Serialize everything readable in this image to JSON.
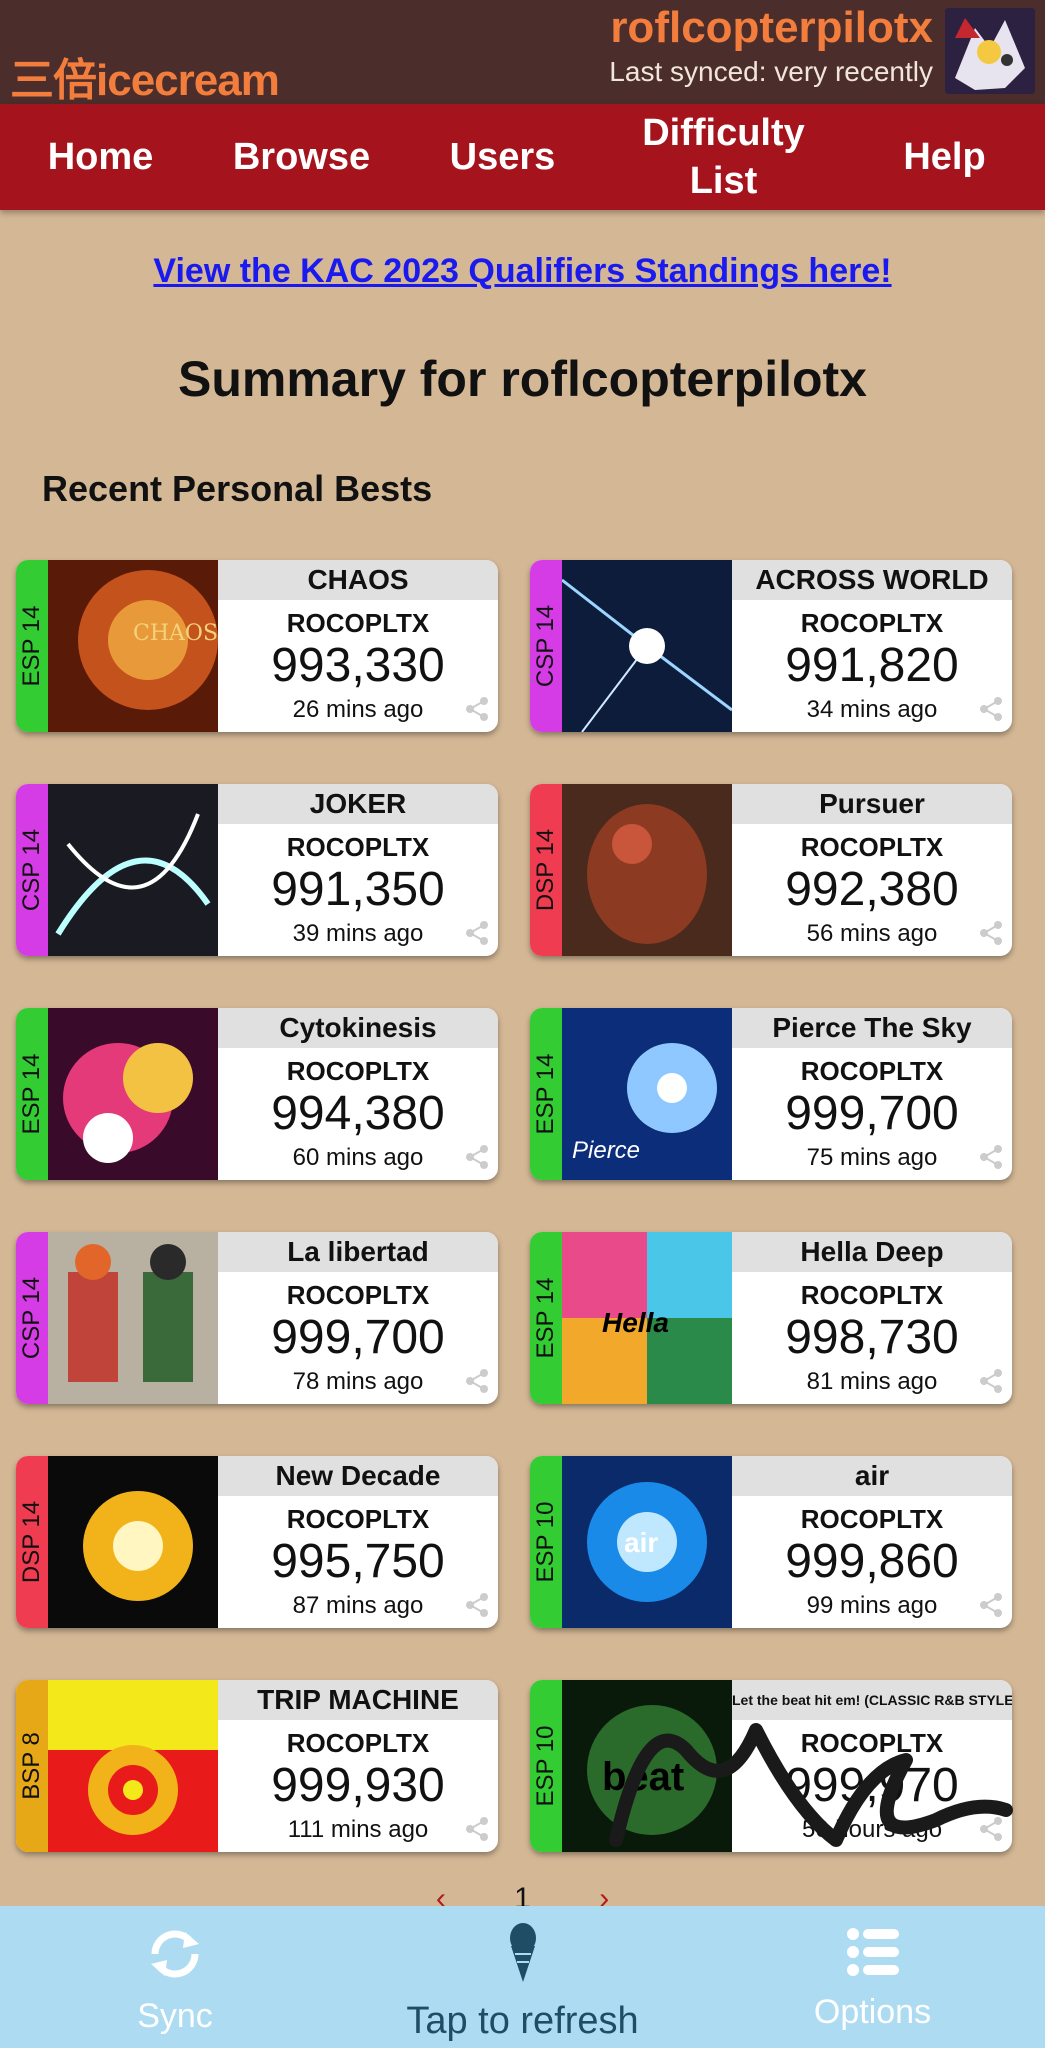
{
  "header": {
    "logo": "三倍icecream",
    "username": "roflcopterpilotx",
    "synced": "Last synced: very recently"
  },
  "nav": {
    "items": [
      "Home",
      "Browse",
      "Users",
      "Difficulty List",
      "Help"
    ]
  },
  "banner": {
    "link_text": "View the KAC 2023 Qualifiers Standings here!"
  },
  "page_title": "Summary for roflcopterpilotx",
  "section_title": "Recent Personal Bests",
  "difficulty_colors": {
    "ESP": "#33cc33",
    "CSP": "#d63ce6",
    "DSP": "#f03c50",
    "BSP": "#e6a817"
  },
  "cards": [
    {
      "diff": "ESP 14",
      "title": "CHAOS",
      "player": "ROCOPLTX",
      "score": "993,330",
      "ago": "26 mins ago"
    },
    {
      "diff": "CSP 14",
      "title": "ACROSS WORLD",
      "player": "ROCOPLTX",
      "score": "991,820",
      "ago": "34 mins ago"
    },
    {
      "diff": "CSP 14",
      "title": "JOKER",
      "player": "ROCOPLTX",
      "score": "991,350",
      "ago": "39 mins ago"
    },
    {
      "diff": "DSP 14",
      "title": "Pursuer",
      "player": "ROCOPLTX",
      "score": "992,380",
      "ago": "56 mins ago"
    },
    {
      "diff": "ESP 14",
      "title": "Cytokinesis",
      "player": "ROCOPLTX",
      "score": "994,380",
      "ago": "60 mins ago"
    },
    {
      "diff": "ESP 14",
      "title": "Pierce The Sky",
      "player": "ROCOPLTX",
      "score": "999,700",
      "ago": "75 mins ago"
    },
    {
      "diff": "CSP 14",
      "title": "La libertad",
      "player": "ROCOPLTX",
      "score": "999,700",
      "ago": "78 mins ago"
    },
    {
      "diff": "ESP 14",
      "title": "Hella Deep",
      "player": "ROCOPLTX",
      "score": "998,730",
      "ago": "81 mins ago"
    },
    {
      "diff": "DSP 14",
      "title": "New Decade",
      "player": "ROCOPLTX",
      "score": "995,750",
      "ago": "87 mins ago"
    },
    {
      "diff": "ESP 10",
      "title": "air",
      "player": "ROCOPLTX",
      "score": "999,860",
      "ago": "99 mins ago"
    },
    {
      "diff": "BSP 8",
      "title": "TRIP MACHINE",
      "player": "ROCOPLTX",
      "score": "999,930",
      "ago": "111 mins ago"
    },
    {
      "diff": "ESP 10",
      "title": "Let the beat hit em! (CLASSIC R&B STYLE)",
      "player": "ROCOPLTX",
      "score": "999,970",
      "ago": "50 hours ago"
    }
  ],
  "pager": {
    "page": "1",
    "prev": "‹",
    "next": "›"
  },
  "bottom_bar": {
    "sync": "Sync",
    "refresh": "Tap to refresh",
    "options": "Options"
  }
}
